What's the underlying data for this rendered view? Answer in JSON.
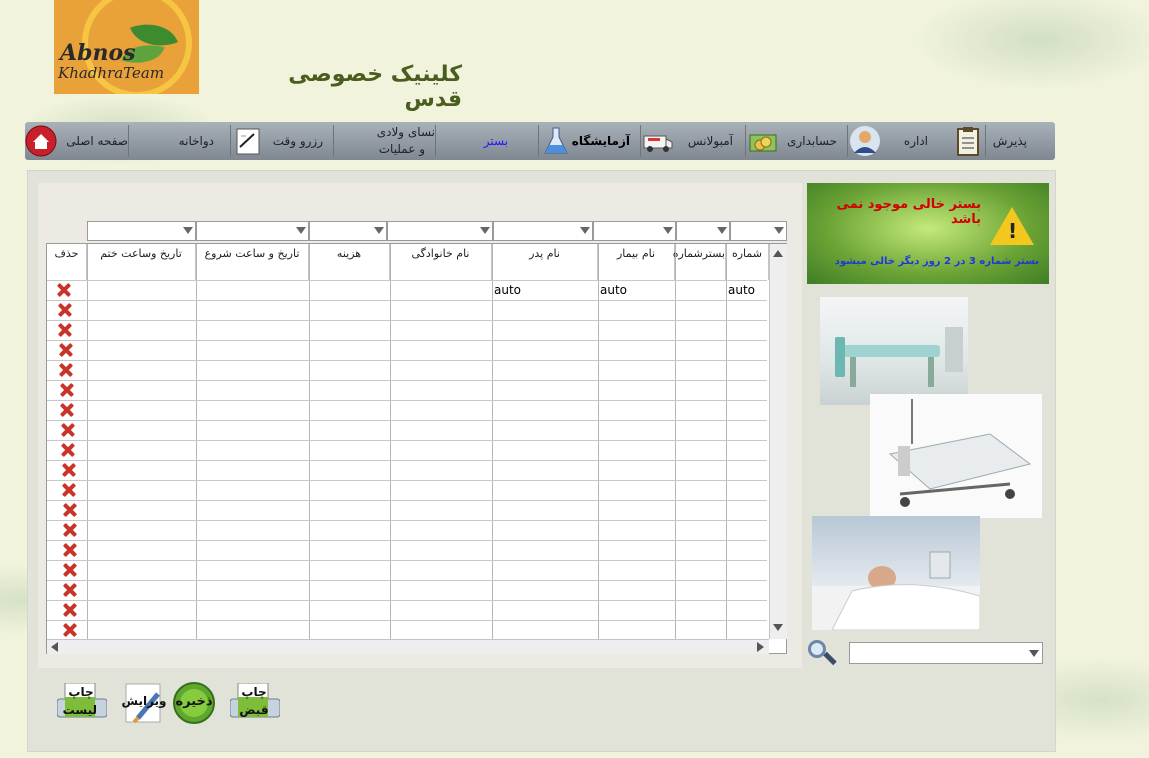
{
  "logo": {
    "line1": "Abnos",
    "line2": "KhadhraTeam"
  },
  "clinic_title": "کلینیک خصوصی قدس",
  "nav": {
    "reception": "پذیرش",
    "admin": "اداره",
    "accounting": "حسابداری",
    "ambulance": "آمبولانس",
    "laboratory": "آزمایشگاه",
    "bed": "بستر",
    "maternity_line1": "نسای ولادی",
    "maternity_line2": "و عملیات",
    "appointment": "رزرو وقت",
    "pharmacy": "دواخانه",
    "home": "صفحه اصلی"
  },
  "table": {
    "headers": {
      "number": "شماره",
      "bed_number": "بسترشماره",
      "patient_name": "نام بیمار",
      "father_name": "نام پدر",
      "family_name": "نام خانوادگی",
      "cost": "هزینه",
      "start": "تاریخ و ساعت شروع",
      "end": "تاریخ وساعت ختم",
      "delete": "حذف"
    },
    "first_row": {
      "number": "auto",
      "patient_name": "auto",
      "father_name": "auto"
    },
    "row_count": 18
  },
  "alert": {
    "message": "بستر خالی موجود نمی باشد",
    "note": "بستر شماره 3 در 2 روز دیگر خالی میشود",
    "message_color": "#d20000",
    "note_color": "#1d3ad6"
  },
  "buttons": {
    "print_list_1": "چاپ",
    "print_list_2": "لیست",
    "edit": "ویرایش",
    "save": "ذخیره",
    "print_receipt_1": "چاپ",
    "print_receipt_2": "قبض"
  }
}
